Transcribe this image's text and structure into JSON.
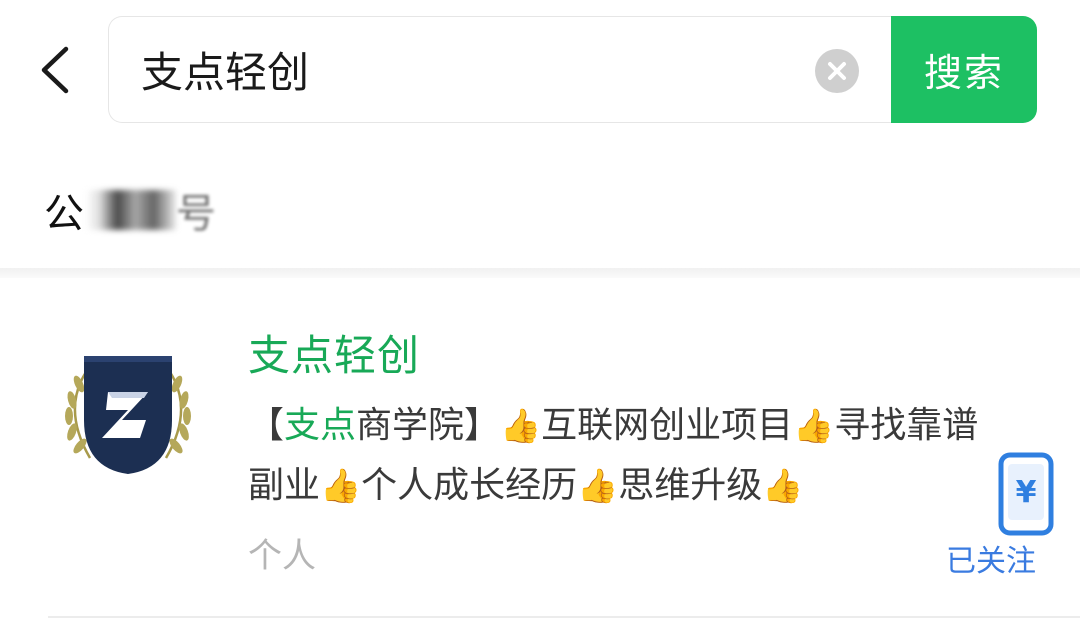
{
  "search": {
    "back_icon": "chevron-left-icon",
    "query": "支点轻创",
    "clear_icon": "close-circle-icon",
    "button_label": "搜索"
  },
  "section": {
    "label_visible": "公",
    "label_tail": "号"
  },
  "result": {
    "name": "支点轻创",
    "desc_prefix": "【",
    "desc_highlight": "支点",
    "desc_items": [
      "商学院】",
      "互联网创业项目",
      "寻找靠谱副业",
      "个人成长经历",
      "思维升级"
    ],
    "thumb_icon": "👍",
    "type": "个人",
    "follow_status": "已关注",
    "avatar_icon": "laurel-shield-logo-icon",
    "wallet_icon": "phone-yuan-icon",
    "wallet_glyph": "¥"
  },
  "colors": {
    "accent_green": "#1dc063",
    "name_green": "#18a957",
    "link_blue": "#3a7be0",
    "shield_navy": "#1c2f52",
    "laurel_gold": "#a89a4b"
  }
}
